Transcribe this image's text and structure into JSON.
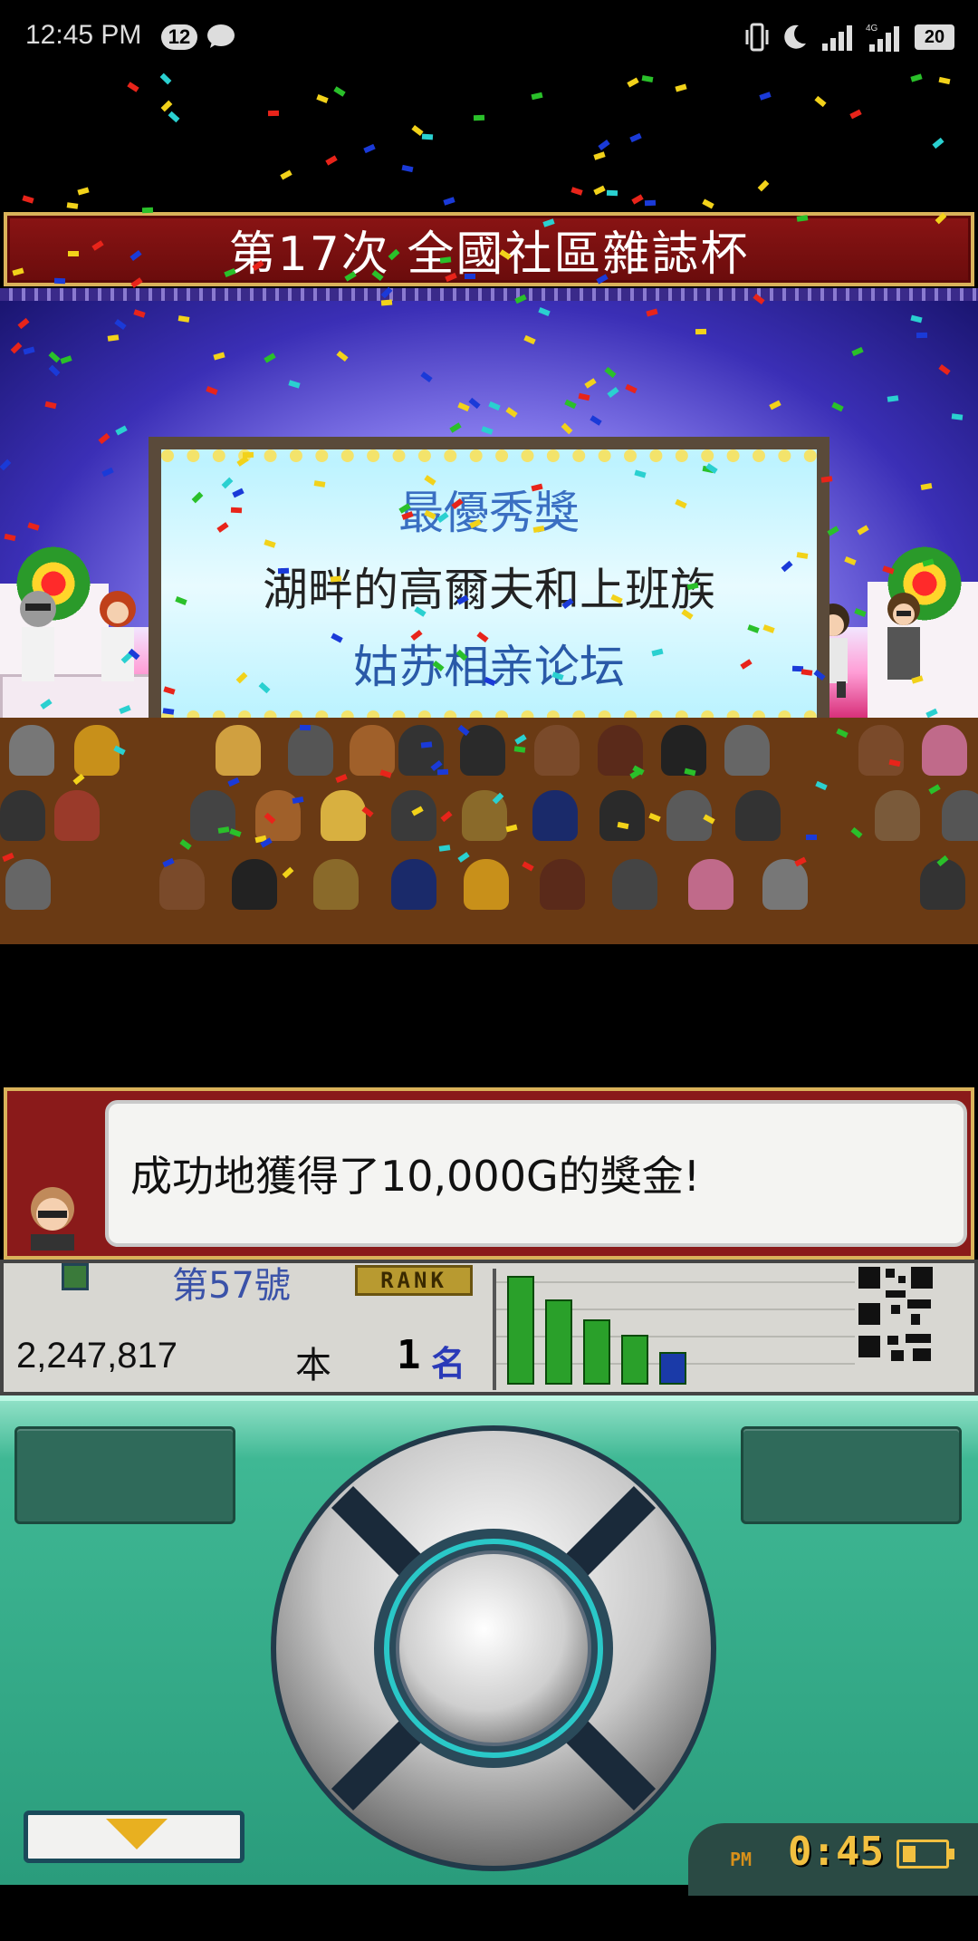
{
  "status_bar": {
    "time": "12:45 PM",
    "notification_count": "12",
    "battery_level": "20",
    "network_label": "4G"
  },
  "game": {
    "title": "第17次 全國社區雜誌杯",
    "award": {
      "title": "最優秀獎",
      "work": "湖畔的高爾夫和上班族",
      "team": "姑苏相亲论坛"
    },
    "dialog": {
      "message": "成功地獲得了10,000G的獎金!"
    },
    "info": {
      "issue": "第57號",
      "rank_tag": "RANK",
      "sales": "2,247,817",
      "sales_unit": "本",
      "rank": "1",
      "rank_unit": "名",
      "chart_bars": [
        {
          "value": 1.0,
          "color": "#2aa02a"
        },
        {
          "value": 0.78,
          "color": "#2aa02a"
        },
        {
          "value": 0.6,
          "color": "#2aa02a"
        },
        {
          "value": 0.46,
          "color": "#2aa02a"
        },
        {
          "value": 0.3,
          "color": "#1a3aa8"
        }
      ]
    },
    "clock": {
      "ampm": "PM",
      "time": "0:45"
    }
  },
  "colors": {
    "banner": "#7a1010",
    "banner_border": "#d9b25a",
    "controller": "#2a9c7c",
    "accent_blue": "#3a52a8"
  }
}
